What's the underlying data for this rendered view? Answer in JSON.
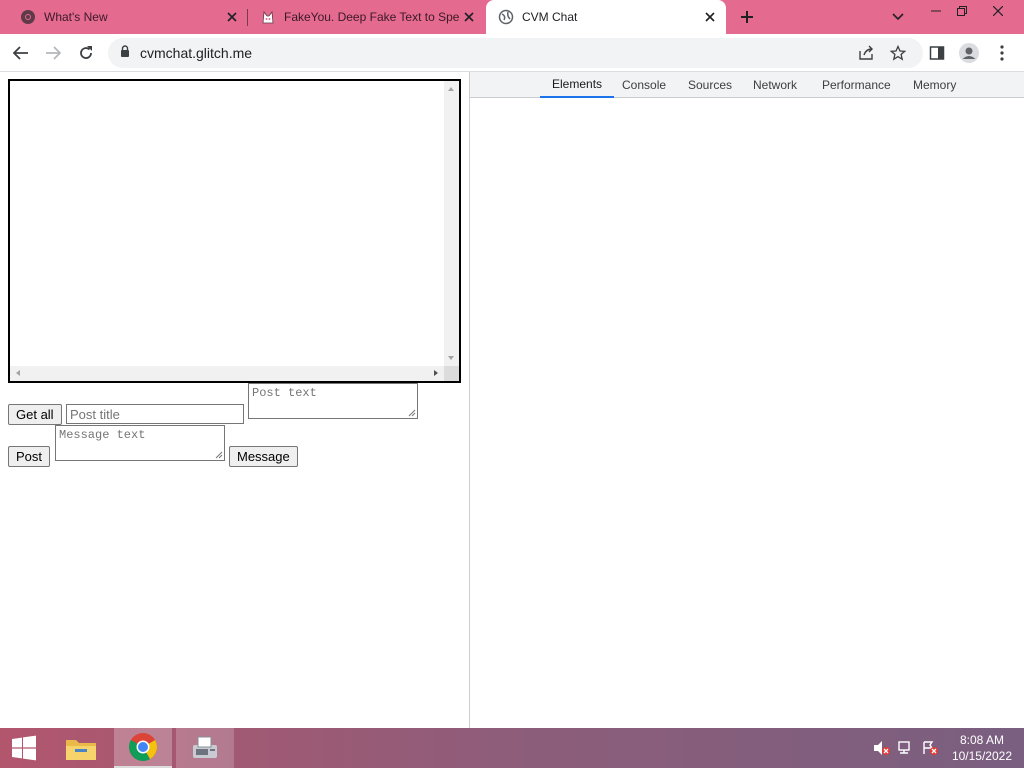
{
  "browser": {
    "tabs": [
      {
        "title": "What's New",
        "icon": "chrome-icon",
        "active": false
      },
      {
        "title": "FakeYou. Deep Fake Text to Speech",
        "icon": "fakeyou-icon",
        "active": false
      },
      {
        "title": "CVM Chat",
        "icon": "globe-icon",
        "active": true
      }
    ],
    "url": "cvmchat.glitch.me"
  },
  "page": {
    "get_all_label": "Get all",
    "post_title_placeholder": "Post title",
    "post_text_placeholder": "Post text",
    "post_label": "Post",
    "message_text_placeholder": "Message text",
    "message_label": "Message"
  },
  "devtools": {
    "tabs": [
      "Elements",
      "Console",
      "Sources",
      "Network",
      "Performance",
      "Memory"
    ],
    "active_tab": "Elements"
  },
  "taskbar": {
    "time": "8:08 AM",
    "date": "10/15/2022"
  },
  "colors": {
    "titlebar": "#e46a90",
    "devtools_accent": "#1a73e8"
  }
}
